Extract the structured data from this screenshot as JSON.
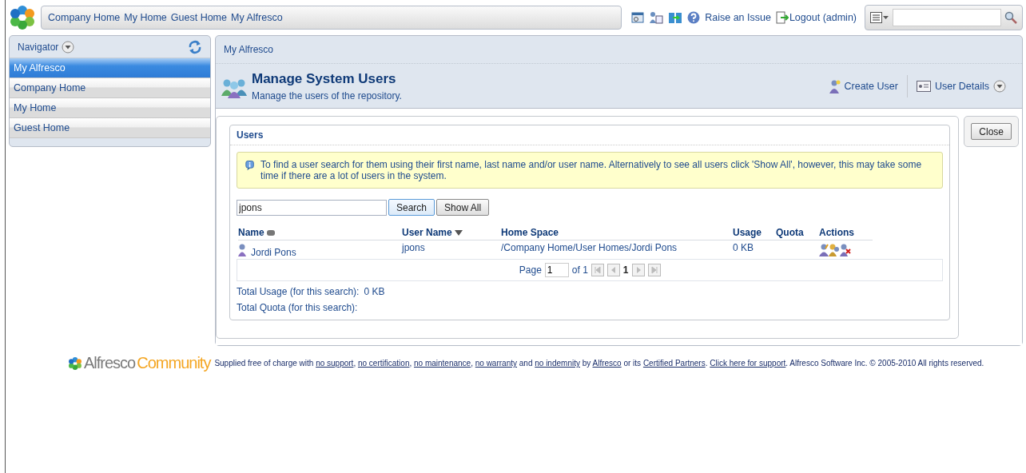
{
  "top_nav": {
    "links": [
      "Company Home",
      "My Home",
      "Guest Home",
      "My Alfresco"
    ],
    "raise_issue": "Raise an Issue",
    "logout": "Logout (admin)"
  },
  "navigator": {
    "title": "Navigator",
    "items": [
      {
        "label": "My Alfresco",
        "selected": true
      },
      {
        "label": "Company Home",
        "selected": false
      },
      {
        "label": "My Home",
        "selected": false
      },
      {
        "label": "Guest Home",
        "selected": false
      }
    ]
  },
  "breadcrumb": "My Alfresco",
  "header": {
    "title": "Manage System Users",
    "subtitle": "Manage the users of the repository.",
    "create_user": "Create User",
    "user_details": "User Details"
  },
  "close_button": "Close",
  "users_panel": {
    "title": "Users",
    "info": "To find a user search for them using their first name, last name and/or user name. Alternatively to see all users click 'Show All', however, this may take some time if there are a lot of users in the system.",
    "search_value": "jpons",
    "search_button": "Search",
    "show_all_button": "Show All",
    "columns": [
      {
        "label": "Name",
        "kind": "sortable"
      },
      {
        "label": "User Name",
        "kind": "sorted"
      },
      {
        "label": "Home Space",
        "kind": "plain"
      },
      {
        "label": "Usage",
        "kind": "plain"
      },
      {
        "label": "Quota",
        "kind": "plain"
      },
      {
        "label": "Actions",
        "kind": "plain"
      }
    ],
    "rows": [
      {
        "name": "Jordi Pons",
        "user_name": "jpons",
        "home_space": "/Company Home/User Homes/Jordi Pons",
        "usage": "0 KB"
      }
    ],
    "pager": {
      "page_label": "Page",
      "page": "1",
      "of": "of 1",
      "current": "1"
    },
    "totals": [
      {
        "label": "Total Usage (for this search):",
        "value": "0 KB"
      },
      {
        "label": "Total Quota (for this search):"
      }
    ]
  },
  "footer": {
    "logo_name": "Alfresco",
    "logo_edition": "Community",
    "segments": [
      {
        "text": "Supplied free of charge with ",
        "kind": "text"
      },
      {
        "text": "no support",
        "kind": "link"
      },
      {
        "text": ", ",
        "kind": "text"
      },
      {
        "text": "no certification",
        "kind": "link"
      },
      {
        "text": ", ",
        "kind": "text"
      },
      {
        "text": "no maintenance",
        "kind": "link"
      },
      {
        "text": ", ",
        "kind": "text"
      },
      {
        "text": "no warranty",
        "kind": "link"
      },
      {
        "text": " and ",
        "kind": "text"
      },
      {
        "text": "no indemnity",
        "kind": "link"
      },
      {
        "text": " by ",
        "kind": "text"
      },
      {
        "text": "Alfresco",
        "kind": "link"
      },
      {
        "text": " or its ",
        "kind": "text"
      },
      {
        "text": "Certified Partners",
        "kind": "link"
      },
      {
        "text": ". ",
        "kind": "text"
      },
      {
        "text": "Click here for support",
        "kind": "link"
      },
      {
        "text": ". Alfresco Software Inc. © 2005-2010 All rights reserved.",
        "kind": "text"
      }
    ]
  }
}
